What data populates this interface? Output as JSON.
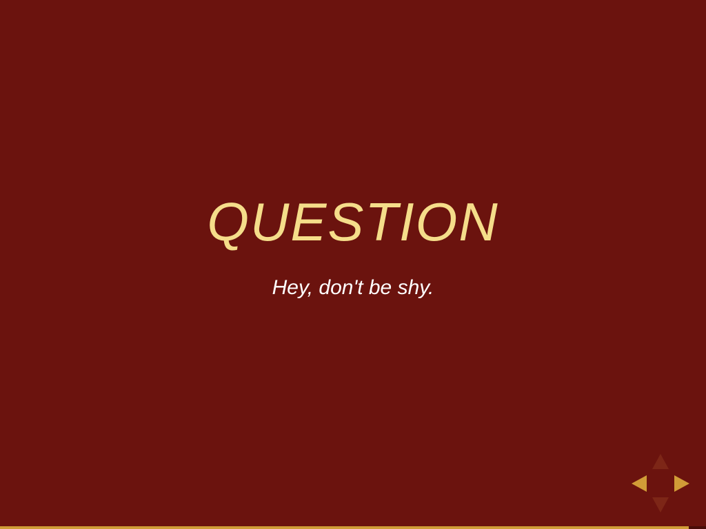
{
  "slide": {
    "title": "QUESTION",
    "subtitle": "Hey, don't be shy."
  },
  "controls": {
    "icons": [
      "arrow-left-icon",
      "arrow-right-icon",
      "arrow-up-icon",
      "arrow-down-icon"
    ],
    "enabled": {
      "left": true,
      "right": true,
      "up": false,
      "down": false
    }
  },
  "progress": {
    "fraction": 0.976
  },
  "colors": {
    "background": "#6b130e",
    "title": "#f5dd8a",
    "subtitle": "#ffffff",
    "accent": "#d19c37",
    "disabled_control": "#7d2617"
  }
}
